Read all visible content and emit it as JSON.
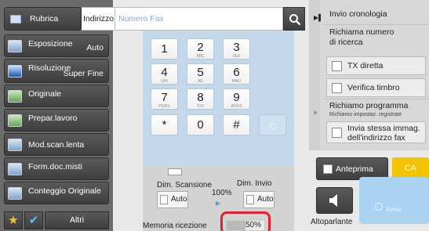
{
  "address_bar": {
    "rubrica_label": "Rubrica",
    "indirizzo_label": "Indirizzo",
    "fax_placeholder": "Numero Fax"
  },
  "sidebar": {
    "items": [
      {
        "label": "Esposizione",
        "value": "Auto"
      },
      {
        "label": "Risoluzione",
        "value": "Super Fine"
      },
      {
        "label": "Originale",
        "value": ""
      },
      {
        "label": "Prepar.lavoro",
        "value": ""
      },
      {
        "label": "Mod.scan.lenta",
        "value": ""
      },
      {
        "label": "Form.doc.misti",
        "value": ""
      },
      {
        "label": "Conteggio Originale",
        "value": ""
      }
    ],
    "altri_label": "Altri"
  },
  "keypad": {
    "keys": [
      {
        "d": "1",
        "s": ""
      },
      {
        "d": "2",
        "s": "ABC"
      },
      {
        "d": "3",
        "s": "DEF"
      },
      {
        "d": "4",
        "s": "GHI"
      },
      {
        "d": "5",
        "s": "JKL"
      },
      {
        "d": "6",
        "s": "MNO"
      },
      {
        "d": "7",
        "s": "PQRS"
      },
      {
        "d": "8",
        "s": "TUV"
      },
      {
        "d": "9",
        "s": "WXYZ"
      },
      {
        "d": "*",
        "s": ""
      },
      {
        "d": "0",
        "s": ""
      },
      {
        "d": "#",
        "s": ""
      },
      {
        "d": "C",
        "s": ""
      }
    ]
  },
  "settings": {
    "dim_scansione_label": "Dim. Scansione",
    "dim_scansione_value": "Auto",
    "ratio": "100%",
    "dim_invio_label": "Dim. Invio",
    "dim_invio_value": "Auto",
    "memoria_label": "Memoria ricezione",
    "memoria_value": "50%",
    "memoria_fraction": 0.5
  },
  "right_panel": {
    "invio_cronologia": "Invio cronologia",
    "richiama_numero": "Richiama numero",
    "richiama_numero_2": "di ricerca",
    "tx_diretta": "TX diretta",
    "verifica_timbro": "Verifica timbro",
    "richiamo_programma": "Richiamo programma",
    "richiamo_sub": "Richiamo impostaz. registrate",
    "invia_stessa_1": "Invia stessa immag.",
    "invia_stessa_2": "dell'indirizzo fax"
  },
  "actions": {
    "anteprima": "Anteprima",
    "ca": "CA",
    "altoparlante": "Altoparlante",
    "avvio": "Avvio"
  },
  "colors": {
    "ca": "#f3c300",
    "avvio": "#a9d3f1",
    "highlight": "#e3202f",
    "keypad_bg": "#c4d8ec"
  }
}
